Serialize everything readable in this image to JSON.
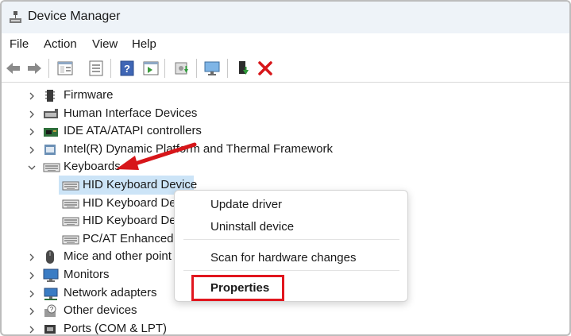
{
  "window": {
    "title": "Device Manager"
  },
  "menu": [
    {
      "label": "File"
    },
    {
      "label": "Action"
    },
    {
      "label": "View"
    },
    {
      "label": "Help"
    }
  ],
  "toolbar": {
    "icons": [
      "back-icon",
      "forward-icon",
      "properties-pane-icon",
      "device-list-icon",
      "help-icon",
      "action-pane-icon",
      "update-driver-icon",
      "scan-hardware-icon",
      "enable-device-icon",
      "uninstall-icon"
    ],
    "uninstall_color": "#d7161a"
  },
  "tree": {
    "categories": [
      {
        "label": "Firmware",
        "icon": "firmware-icon"
      },
      {
        "label": "Human Interface Devices",
        "icon": "hid-icon"
      },
      {
        "label": "IDE ATA/ATAPI controllers",
        "icon": "ide-controller-icon"
      },
      {
        "label": "Intel(R) Dynamic Platform and Thermal Framework",
        "icon": "intel-dptf-icon"
      },
      {
        "label": "Keyboards",
        "icon": "keyboard-icon",
        "expanded": true
      },
      {
        "label": "Mice and other point",
        "icon": "mouse-icon"
      },
      {
        "label": "Monitors",
        "icon": "monitor-icon"
      },
      {
        "label": "Network adapters",
        "icon": "network-adapter-icon"
      },
      {
        "label": "Other devices",
        "icon": "unknown-device-icon"
      },
      {
        "label": "Ports (COM & LPT)",
        "icon": "port-icon"
      }
    ],
    "keyboards_children": [
      {
        "label": "HID Keyboard Device",
        "selected": true
      },
      {
        "label": "HID Keyboard Dev"
      },
      {
        "label": "HID Keyboard Dev"
      },
      {
        "label": "PC/AT Enhanced P"
      }
    ]
  },
  "context_menu": {
    "items": [
      "Update driver",
      "Uninstall device",
      "Scan for hardware changes",
      "Properties"
    ]
  },
  "annotation": {
    "highlight_color": "#e1161e",
    "arrow_color": "#d7161a"
  }
}
